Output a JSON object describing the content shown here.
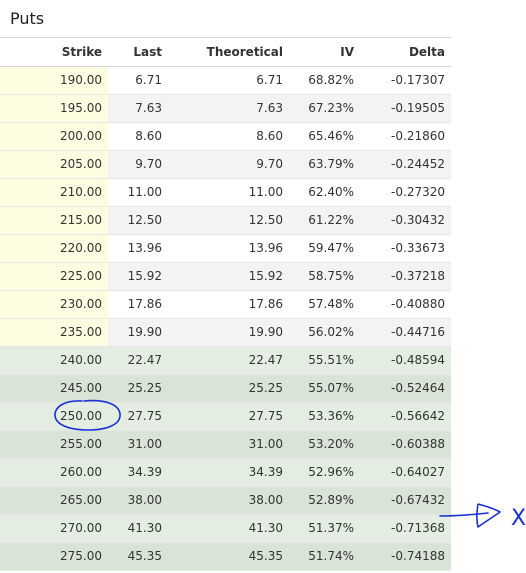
{
  "title": "Puts",
  "columns": [
    "Strike",
    "Last",
    "Theoretical",
    "IV",
    "Delta"
  ],
  "rows": [
    {
      "strike": "190.00",
      "last": "6.71",
      "theoretical": "6.71",
      "iv": "68.82%",
      "delta": "-0.17307",
      "moneyness": "otm"
    },
    {
      "strike": "195.00",
      "last": "7.63",
      "theoretical": "7.63",
      "iv": "67.23%",
      "delta": "-0.19505",
      "moneyness": "otm"
    },
    {
      "strike": "200.00",
      "last": "8.60",
      "theoretical": "8.60",
      "iv": "65.46%",
      "delta": "-0.21860",
      "moneyness": "otm"
    },
    {
      "strike": "205.00",
      "last": "9.70",
      "theoretical": "9.70",
      "iv": "63.79%",
      "delta": "-0.24452",
      "moneyness": "otm"
    },
    {
      "strike": "210.00",
      "last": "11.00",
      "theoretical": "11.00",
      "iv": "62.40%",
      "delta": "-0.27320",
      "moneyness": "otm"
    },
    {
      "strike": "215.00",
      "last": "12.50",
      "theoretical": "12.50",
      "iv": "61.22%",
      "delta": "-0.30432",
      "moneyness": "otm"
    },
    {
      "strike": "220.00",
      "last": "13.96",
      "theoretical": "13.96",
      "iv": "59.47%",
      "delta": "-0.33673",
      "moneyness": "otm"
    },
    {
      "strike": "225.00",
      "last": "15.92",
      "theoretical": "15.92",
      "iv": "58.75%",
      "delta": "-0.37218",
      "moneyness": "otm"
    },
    {
      "strike": "230.00",
      "last": "17.86",
      "theoretical": "17.86",
      "iv": "57.48%",
      "delta": "-0.40880",
      "moneyness": "otm"
    },
    {
      "strike": "235.00",
      "last": "19.90",
      "theoretical": "19.90",
      "iv": "56.02%",
      "delta": "-0.44716",
      "moneyness": "otm"
    },
    {
      "strike": "240.00",
      "last": "22.47",
      "theoretical": "22.47",
      "iv": "55.51%",
      "delta": "-0.48594",
      "moneyness": "itm"
    },
    {
      "strike": "245.00",
      "last": "25.25",
      "theoretical": "25.25",
      "iv": "55.07%",
      "delta": "-0.52464",
      "moneyness": "itm"
    },
    {
      "strike": "250.00",
      "last": "27.75",
      "theoretical": "27.75",
      "iv": "53.36%",
      "delta": "-0.56642",
      "moneyness": "itm"
    },
    {
      "strike": "255.00",
      "last": "31.00",
      "theoretical": "31.00",
      "iv": "53.20%",
      "delta": "-0.60388",
      "moneyness": "itm"
    },
    {
      "strike": "260.00",
      "last": "34.39",
      "theoretical": "34.39",
      "iv": "52.96%",
      "delta": "-0.64027",
      "moneyness": "itm"
    },
    {
      "strike": "265.00",
      "last": "38.00",
      "theoretical": "38.00",
      "iv": "52.89%",
      "delta": "-0.67432",
      "moneyness": "itm"
    },
    {
      "strike": "270.00",
      "last": "41.30",
      "theoretical": "41.30",
      "iv": "51.37%",
      "delta": "-0.71368",
      "moneyness": "itm"
    },
    {
      "strike": "275.00",
      "last": "45.35",
      "theoretical": "45.35",
      "iv": "51.74%",
      "delta": "-0.74188",
      "moneyness": "itm"
    }
  ],
  "annotations": {
    "circled_strike": "250.00",
    "arrow_row_strike": "265.00",
    "arrow_mark": "X",
    "ink_color": "#1a2fd6"
  },
  "colors": {
    "otm_highlight": "#fffde1",
    "itm_row": "#e3ede1",
    "itm_row_alt": "#d8e4d5",
    "otm_row_alt": "#f3f3f3"
  }
}
